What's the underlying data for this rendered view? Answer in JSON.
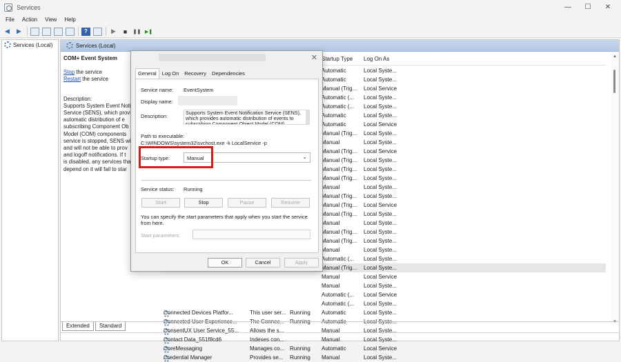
{
  "window": {
    "title": "Services",
    "min": "—",
    "max": "☐",
    "close": "✕"
  },
  "menu": [
    "File",
    "Action",
    "View",
    "Help"
  ],
  "toolbar": {
    "back": "◀",
    "forward": "▶",
    "help": "?",
    "play": "▶",
    "stop": "■",
    "pause": "❚❚",
    "restart": "▶❚"
  },
  "left": {
    "node": "Services (Local)"
  },
  "main": {
    "header": "Services (Local)",
    "desc": {
      "title": "COM+ Event System",
      "stop_link": "Stop",
      "stop_rest": " the service",
      "restart_link": "Restart",
      "restart_rest": " the service",
      "desc_label": "Description:",
      "lines": [
        "Supports System Event Noti",
        "Service (SENS), which provi",
        "automatic distribution of e",
        "subscribing Component Ob",
        "Model (COM) components",
        "service is stopped, SENS wi",
        "and will not be able to prov",
        "and logoff notifications. If t",
        "is disabled, any services tha",
        "depend on it will fail to star"
      ]
    },
    "columns": {
      "startup": "Startup Type",
      "logon": "Log On As"
    },
    "rows": [
      {
        "name": "",
        "desc": "",
        "status": "",
        "startup": "Automatic",
        "logon": "Local Syste..."
      },
      {
        "name": "",
        "desc": "",
        "status": "",
        "startup": "Automatic",
        "logon": "Local Syste..."
      },
      {
        "name": "",
        "desc": "",
        "status": "",
        "startup": "Manual (Trig...",
        "logon": "Local Service"
      },
      {
        "name": "",
        "desc": "",
        "status": "",
        "startup": "Automatic (...",
        "logon": "Local Syste..."
      },
      {
        "name": "",
        "desc": "",
        "status": "",
        "startup": "Automatic (...",
        "logon": "Local Syste..."
      },
      {
        "name": "",
        "desc": "",
        "status": "",
        "startup": "Automatic",
        "logon": "Local Syste..."
      },
      {
        "name": "",
        "desc": "",
        "status": "",
        "startup": "Automatic",
        "logon": "Local Service"
      },
      {
        "name": "",
        "desc": "",
        "status": "",
        "startup": "Manual (Trig...",
        "logon": "Local Syste..."
      },
      {
        "name": "",
        "desc": "",
        "status": "",
        "startup": "Manual",
        "logon": "Local Syste..."
      },
      {
        "name": "",
        "desc": "",
        "status": "",
        "startup": "Manual (Trig...",
        "logon": "Local Service"
      },
      {
        "name": "",
        "desc": "",
        "status": "",
        "startup": "Manual (Trig...",
        "logon": "Local Syste..."
      },
      {
        "name": "",
        "desc": "",
        "status": "",
        "startup": "Manual (Trig...",
        "logon": "Local Syste..."
      },
      {
        "name": "",
        "desc": "",
        "status": "",
        "startup": "Manual (Trig...",
        "logon": "Local Syste..."
      },
      {
        "name": "",
        "desc": "",
        "status": "",
        "startup": "Manual",
        "logon": "Local Syste..."
      },
      {
        "name": "",
        "desc": "",
        "status": "",
        "startup": "Manual (Trig...",
        "logon": "Local Syste..."
      },
      {
        "name": "",
        "desc": "",
        "status": "",
        "startup": "Manual (Trig...",
        "logon": "Local Service"
      },
      {
        "name": "",
        "desc": "",
        "status": "",
        "startup": "Manual (Trig...",
        "logon": "Local Syste..."
      },
      {
        "name": "",
        "desc": "",
        "status": "",
        "startup": "Manual",
        "logon": "Local Syste..."
      },
      {
        "name": "",
        "desc": "",
        "status": "",
        "startup": "Manual (Trig...",
        "logon": "Local Syste..."
      },
      {
        "name": "",
        "desc": "",
        "status": "",
        "startup": "Manual (Trig...",
        "logon": "Local Syste..."
      },
      {
        "name": "",
        "desc": "",
        "status": "",
        "startup": "Manual",
        "logon": "Local Syste..."
      },
      {
        "name": "",
        "desc": "",
        "status": "",
        "startup": "Automatic (...",
        "logon": "Local Syste..."
      },
      {
        "name": "",
        "desc": "",
        "status": "",
        "startup": "Manual (Trig...",
        "logon": "Local Syste..."
      },
      {
        "name": "",
        "desc": "",
        "status": "",
        "startup": "Manual",
        "logon": "Local Service"
      },
      {
        "name": "",
        "desc": "",
        "status": "",
        "startup": "Manual",
        "logon": "Local Syste..."
      },
      {
        "name": "",
        "desc": "",
        "status": "",
        "startup": "Automatic (...",
        "logon": "Local Service"
      },
      {
        "name": "",
        "desc": "",
        "status": "",
        "startup": "Automatic (...",
        "logon": "Local Syste..."
      },
      {
        "name": "Connected Devices Platfor...",
        "desc": "This user ser...",
        "status": "Running",
        "startup": "Automatic",
        "logon": "Local Syste..."
      },
      {
        "name": "Connected User Experience...",
        "desc": "The Connec...",
        "status": "Running",
        "startup": "Automatic",
        "logon": "Local Syste..."
      },
      {
        "name": "ConsentUX User Service_55...",
        "desc": "Allows the s...",
        "status": "",
        "startup": "Manual",
        "logon": "Local Syste..."
      },
      {
        "name": "Contact Data_551f8cd6",
        "desc": "Indexes con...",
        "status": "",
        "startup": "Manual",
        "logon": "Local Syste..."
      },
      {
        "name": "CoreMessaging",
        "desc": "Manages co...",
        "status": "Running",
        "startup": "Automatic",
        "logon": "Local Service"
      },
      {
        "name": "Credential Manager",
        "desc": "Provides se...",
        "status": "Running",
        "startup": "Manual",
        "logon": "Local Syste..."
      }
    ],
    "tabs": [
      "Extended",
      "Standard"
    ]
  },
  "dialog": {
    "tabs": [
      "General",
      "Log On",
      "Recovery",
      "Dependencies"
    ],
    "service_name_label": "Service name:",
    "service_name": "EventSystem",
    "display_name_label": "Display name:",
    "description_label": "Description:",
    "description": "Supports System Event Notification Service (SENS), which provides automatic distribution of events to subscribing Component Object Model (COM)",
    "path_label": "Path to executable:",
    "path": "C:\\WINDOWS\\system32\\svchost.exe -k LocalService -p",
    "startup_label": "Startup type:",
    "startup_value": "Manual",
    "status_label": "Service status:",
    "status_value": "Running",
    "buttons": {
      "start": "Start",
      "stop": "Stop",
      "pause": "Pause",
      "resume": "Resume"
    },
    "hint": "You can specify the start parameters that apply when you start the service from here.",
    "params_label": "Start parameters:",
    "ok": "OK",
    "cancel": "Cancel",
    "apply": "Apply",
    "close": "✕"
  }
}
